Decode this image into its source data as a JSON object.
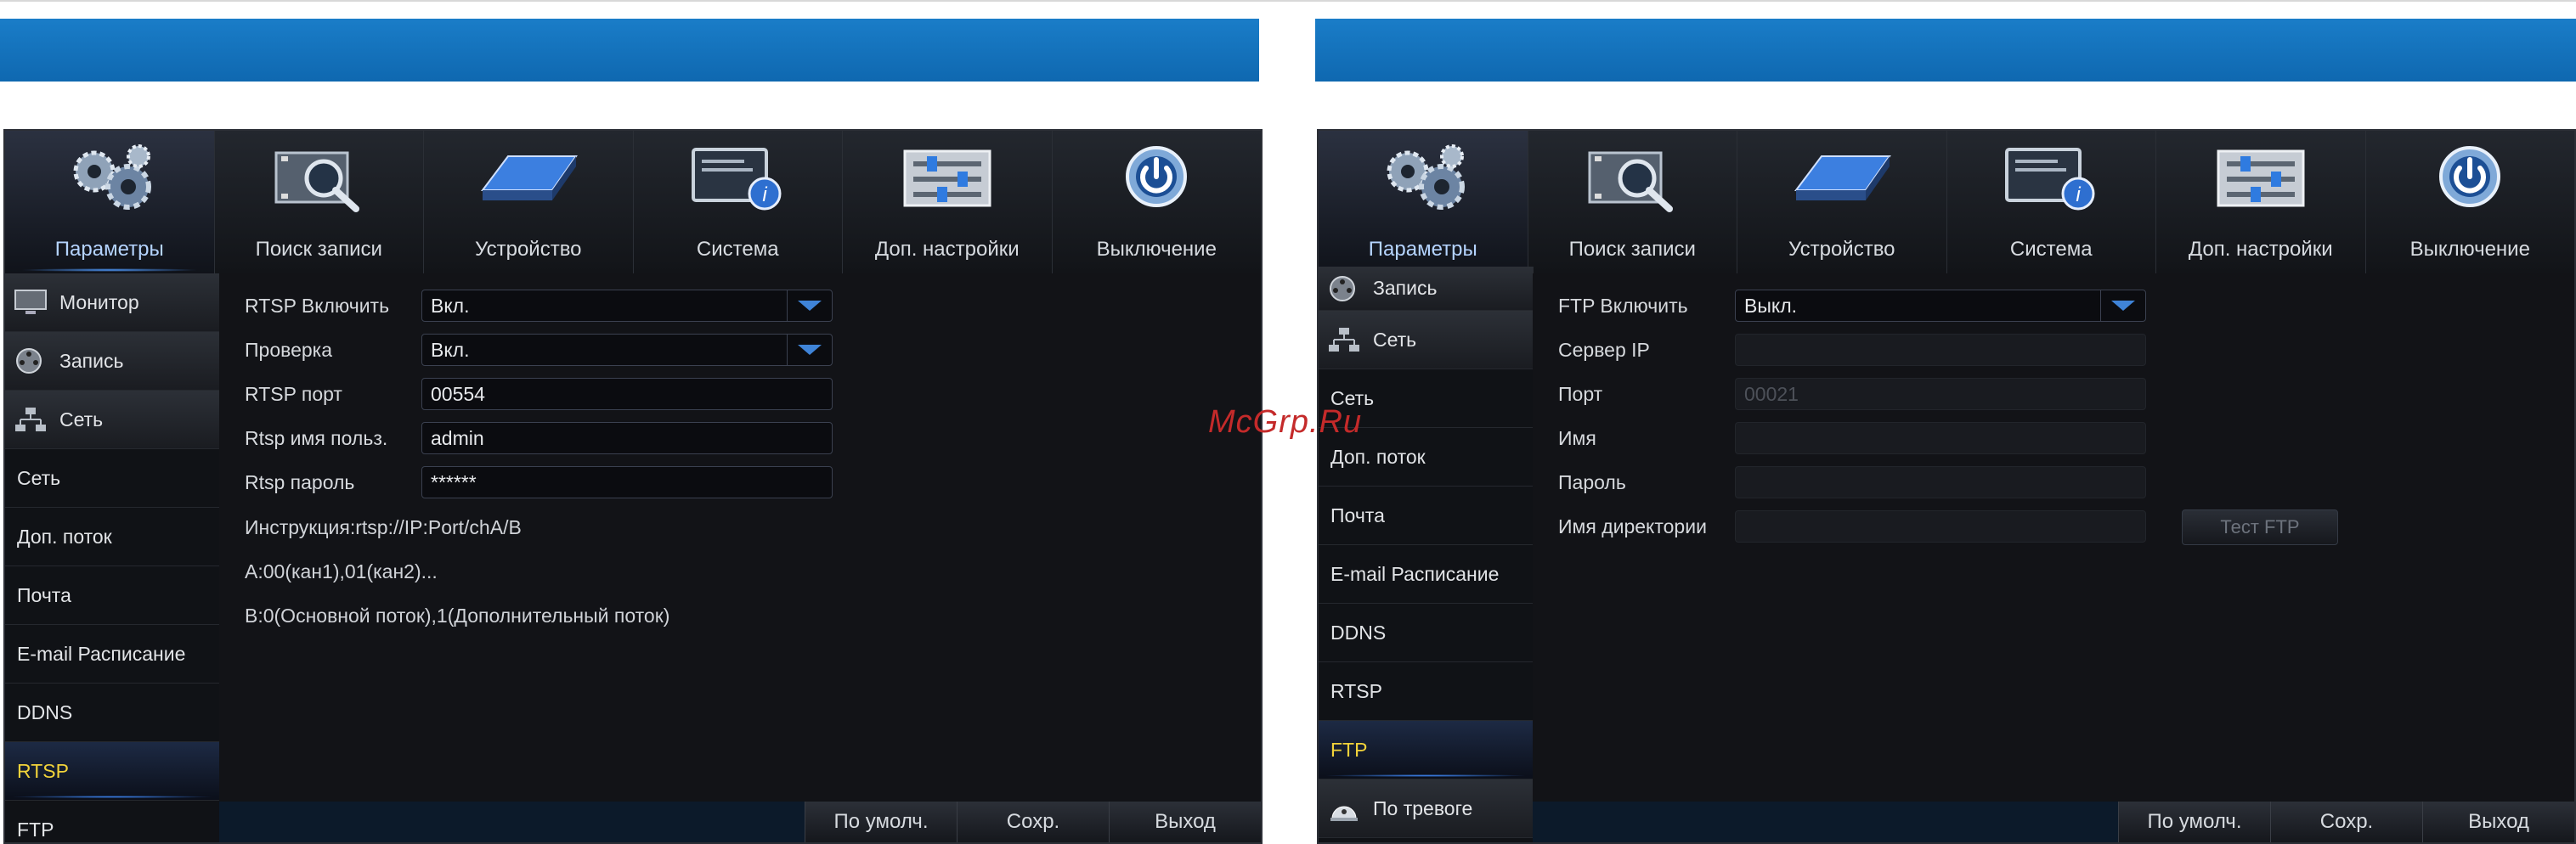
{
  "watermark": "McGrp.Ru",
  "screens": [
    {
      "tabs": [
        {
          "label": "Параметры",
          "icon": "gears-icon"
        },
        {
          "label": "Поиск записи",
          "icon": "film-search-icon"
        },
        {
          "label": "Устройство",
          "icon": "hdd-icon"
        },
        {
          "label": "Система",
          "icon": "monitor-info-icon"
        },
        {
          "label": "Доп. настройки",
          "icon": "sliders-icon"
        },
        {
          "label": "Выключение",
          "icon": "power-icon"
        }
      ],
      "sidebar": {
        "main_items": [
          {
            "label": "Монитор",
            "icon": "monitor-icon"
          },
          {
            "label": "Запись",
            "icon": "film-reel-icon"
          },
          {
            "label": "Сеть",
            "icon": "network-icon"
          }
        ],
        "sub_items": [
          "Сеть",
          "Доп. поток",
          "Почта",
          "E-mail Расписание",
          "DDNS",
          "RTSP",
          "FTP"
        ],
        "active": "RTSP"
      },
      "form": {
        "rtsp_enable_label": "RTSP Включить",
        "rtsp_enable_value": "Вкл.",
        "check_label": "Проверка",
        "check_value": "Вкл.",
        "port_label": "RTSP порт",
        "port_value": "00554",
        "user_label": "Rtsp имя польз.",
        "user_value": "admin",
        "password_label": "Rtsp пароль",
        "password_value": "******",
        "info_1": "Инструкция:rtsp://IP:Port/chA/B",
        "info_2": "A:00(кан1),01(кан2)...",
        "info_3": "B:0(Основной поток),1(Дополнительный поток)"
      },
      "buttons": {
        "default": "По умолч.",
        "save": "Сохр.",
        "exit": "Выход"
      }
    },
    {
      "tabs": [
        {
          "label": "Параметры",
          "icon": "gears-icon"
        },
        {
          "label": "Поиск записи",
          "icon": "film-search-icon"
        },
        {
          "label": "Устройство",
          "icon": "hdd-icon"
        },
        {
          "label": "Система",
          "icon": "monitor-info-icon"
        },
        {
          "label": "Доп. настройки",
          "icon": "sliders-icon"
        },
        {
          "label": "Выключение",
          "icon": "power-icon"
        }
      ],
      "sidebar": {
        "main_items_top": [
          {
            "label": "Запись",
            "icon": "film-reel-icon"
          },
          {
            "label": "Сеть",
            "icon": "network-icon"
          }
        ],
        "sub_items": [
          "Сеть",
          "Доп. поток",
          "Почта",
          "E-mail Расписание",
          "DDNS",
          "RTSP",
          "FTP"
        ],
        "main_items_bottom": [
          {
            "label": "По тревоге",
            "icon": "alarm-icon"
          }
        ],
        "active": "FTP"
      },
      "form": {
        "ftp_enable_label": "FTP Включить",
        "ftp_enable_value": "Выкл.",
        "server_label": "Сервер IP",
        "server_value": "",
        "port_label": "Порт",
        "port_value": "00021",
        "name_label": "Имя",
        "name_value": "",
        "password_label": "Пароль",
        "password_value": "",
        "dir_label": "Имя директории",
        "dir_value": "",
        "test_button": "Тест FTP"
      },
      "buttons": {
        "default": "По умолч.",
        "save": "Сохр.",
        "exit": "Выход"
      }
    }
  ]
}
